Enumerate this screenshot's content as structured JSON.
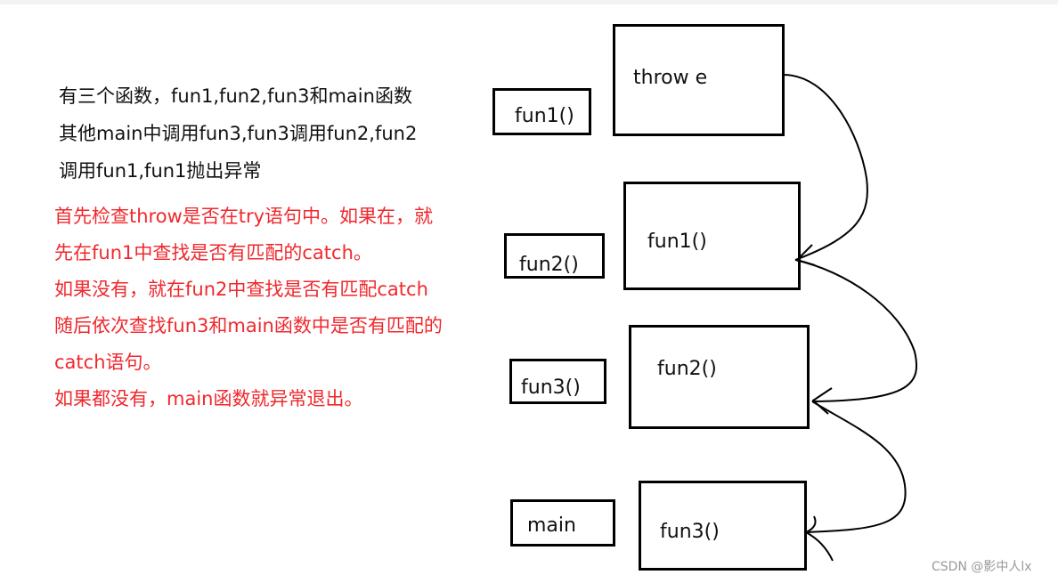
{
  "description_lines": [
    "有三个函数，fun1,fun2,fun3和main函数",
    "其他main中调用fun3,fun3调用fun2,fun2",
    "调用fun1,fun1抛出异常"
  ],
  "explanation_lines": [
    "首先检查throw是否在try语句中。如果在，就",
    "先在fun1中查找是否有匹配的catch。",
    "如果没有，就在fun2中查找是否有匹配catch",
    "随后依次查找fun3和main函数中是否有匹配的",
    "catch语句。",
    "如果都没有，main函数就异常退出。"
  ],
  "call_labels": [
    "fun1()",
    "fun2()",
    "fun3()",
    "main"
  ],
  "stack_boxes": [
    "throw e",
    "fun1()",
    "fun2()",
    "fun3()"
  ],
  "watermark": "CSDN @影中人lx",
  "colors": {
    "explanation": "#f0282d",
    "text": "#111111"
  }
}
